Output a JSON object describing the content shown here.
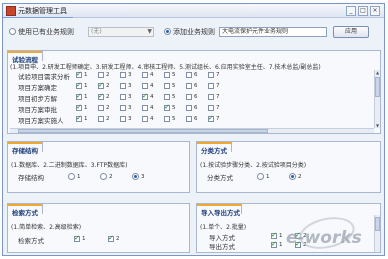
{
  "window": {
    "title": "元数据管理工具",
    "minimize": "_",
    "maximize": "□",
    "close": "×"
  },
  "rule_bar": {
    "existing_label": "使用已有业务规则",
    "existing_select_value": "(无)",
    "add_label": "添加业务规则",
    "rule_name_value": "大电流保护元件业务规则",
    "apply_button": "应用"
  },
  "process": {
    "tab": "试验流程",
    "description": "(1.项目申、2.研发工程师确定、3.研发工程师、4.审核工程师、5.测试组长、6.应用实验室主任、7.技术总监/副总监)",
    "rows": [
      {
        "label": "试验项目需求分析",
        "checks": [
          true,
          false,
          false,
          false,
          false,
          false,
          false
        ]
      },
      {
        "label": "项目方案确定",
        "checks": [
          true,
          true,
          false,
          false,
          false,
          false,
          false
        ]
      },
      {
        "label": "项目初步方解",
        "checks": [
          true,
          true,
          false,
          true,
          false,
          false,
          false
        ]
      },
      {
        "label": "项目方案审批",
        "checks": [
          true,
          false,
          false,
          false,
          true,
          false,
          false
        ]
      },
      {
        "label": "项目方案实施人",
        "checks": [
          true,
          false,
          false,
          false,
          false,
          false,
          true
        ]
      }
    ],
    "check_numbers": [
      "1",
      "2",
      "3",
      "4",
      "5",
      "6",
      "7"
    ]
  },
  "storage": {
    "tab": "存储结构",
    "description": "(1.数据库、2.二进制数据库、3.FTP数据库)",
    "row_label": "存储结构",
    "options": [
      "1",
      "2",
      "3"
    ],
    "selected": 2
  },
  "classify": {
    "tab": "分类方式",
    "description": "(1.按试验步骤分类、2.按试验项目分类)",
    "row_label": "分类方式",
    "options": [
      "1",
      "2"
    ],
    "selected": 1
  },
  "retrieve": {
    "tab": "检索方式",
    "description": "(1.简单检索、2.高级检索)",
    "row_label": "检索方式",
    "checks": [
      {
        "n": "1",
        "on": true
      },
      {
        "n": "2",
        "on": true
      }
    ]
  },
  "import_export": {
    "tab": "导入导出方式",
    "description": "(1.单个、2.批量)",
    "rows": [
      {
        "label": "导入方式",
        "checks": [
          {
            "n": "1",
            "on": true
          },
          {
            "n": "2",
            "on": true
          }
        ]
      },
      {
        "label": "导出方式",
        "checks": [
          {
            "n": "1",
            "on": true
          },
          {
            "n": "2",
            "on": true
          }
        ]
      }
    ]
  },
  "watermark": "e-works"
}
